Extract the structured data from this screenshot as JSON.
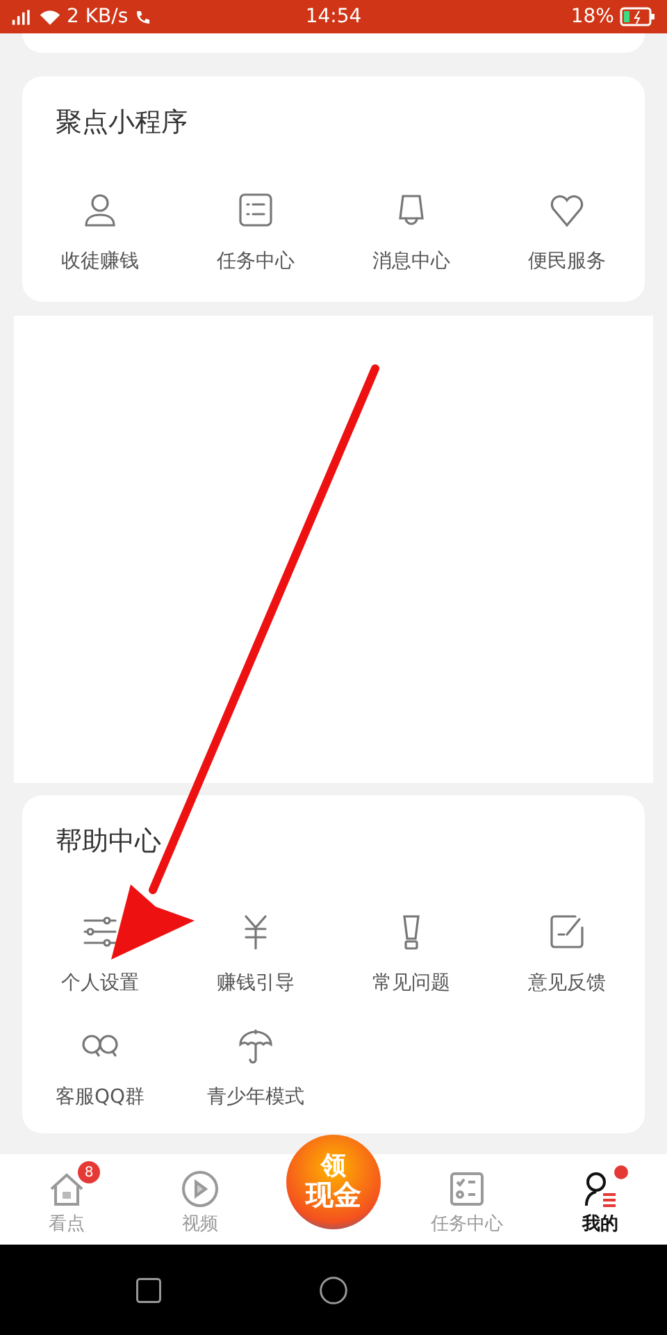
{
  "status_bar": {
    "speed": "2 KB/s",
    "time": "14:54",
    "battery": "18%"
  },
  "mini_programs": {
    "title": "聚点小程序",
    "items": [
      {
        "label": "收徒赚钱",
        "kind": "person"
      },
      {
        "label": "任务中心",
        "kind": "list"
      },
      {
        "label": "消息中心",
        "kind": "bell"
      },
      {
        "label": "便民服务",
        "kind": "heart"
      }
    ]
  },
  "help_center": {
    "title": "帮助中心",
    "items": [
      {
        "label": "个人设置",
        "kind": "sliders"
      },
      {
        "label": "赚钱引导",
        "kind": "yuan"
      },
      {
        "label": "常见问题",
        "kind": "cup"
      },
      {
        "label": "意见反馈",
        "kind": "edit"
      },
      {
        "label": "客服QQ群",
        "kind": "qq"
      },
      {
        "label": "青少年模式",
        "kind": "umbrella"
      }
    ]
  },
  "tab_bar": {
    "tabs": [
      {
        "label": "看点",
        "kind": "home",
        "badge": "8",
        "selected": false
      },
      {
        "label": "视频",
        "kind": "play",
        "selected": false
      },
      {
        "kind": "promo",
        "line_1": "领",
        "line_2": "现金",
        "selected": false
      },
      {
        "label": "任务中心",
        "kind": "tasks",
        "selected": false
      },
      {
        "label": "我的",
        "kind": "me",
        "dot": true,
        "selected": true
      }
    ]
  }
}
